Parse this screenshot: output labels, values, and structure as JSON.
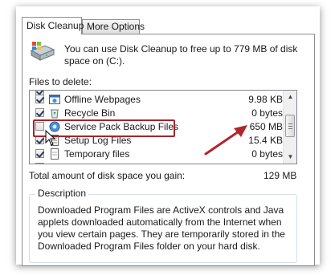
{
  "tabs": [
    {
      "label": "Disk Cleanup",
      "active": true
    },
    {
      "label": "More Options",
      "active": false
    }
  ],
  "header": {
    "line1": "You can use Disk Cleanup to free up to 779 MB of disk",
    "line2": "space on  (C:)."
  },
  "files_label": "Files to delete:",
  "files": [
    {
      "name": "Offline Webpages",
      "size": "9.98 KB",
      "checked": true,
      "icon": "offline-webpages-icon"
    },
    {
      "name": "Recycle Bin",
      "size": "0 bytes",
      "checked": true,
      "icon": "recycle-bin-icon"
    },
    {
      "name": "Service Pack Backup Files",
      "size": "650 MB",
      "checked": false,
      "icon": "service-pack-icon"
    },
    {
      "name": "Setup Log Files",
      "size": "15.4 KB",
      "checked": true,
      "icon": "setup-log-icon"
    },
    {
      "name": "Temporary files",
      "size": "0 bytes",
      "checked": true,
      "icon": "temporary-files-icon"
    }
  ],
  "total": {
    "label": "Total amount of disk space you gain:",
    "value": "129 MB"
  },
  "description": {
    "legend": "Description",
    "text": "Downloaded Program Files are ActiveX controls and Java applets downloaded automatically from the Internet when you view certain pages. They are temporarily stored in the Downloaded Program Files folder on your hard disk."
  },
  "colors": {
    "highlight": "#a3252b",
    "arrow": "#b0262c"
  }
}
